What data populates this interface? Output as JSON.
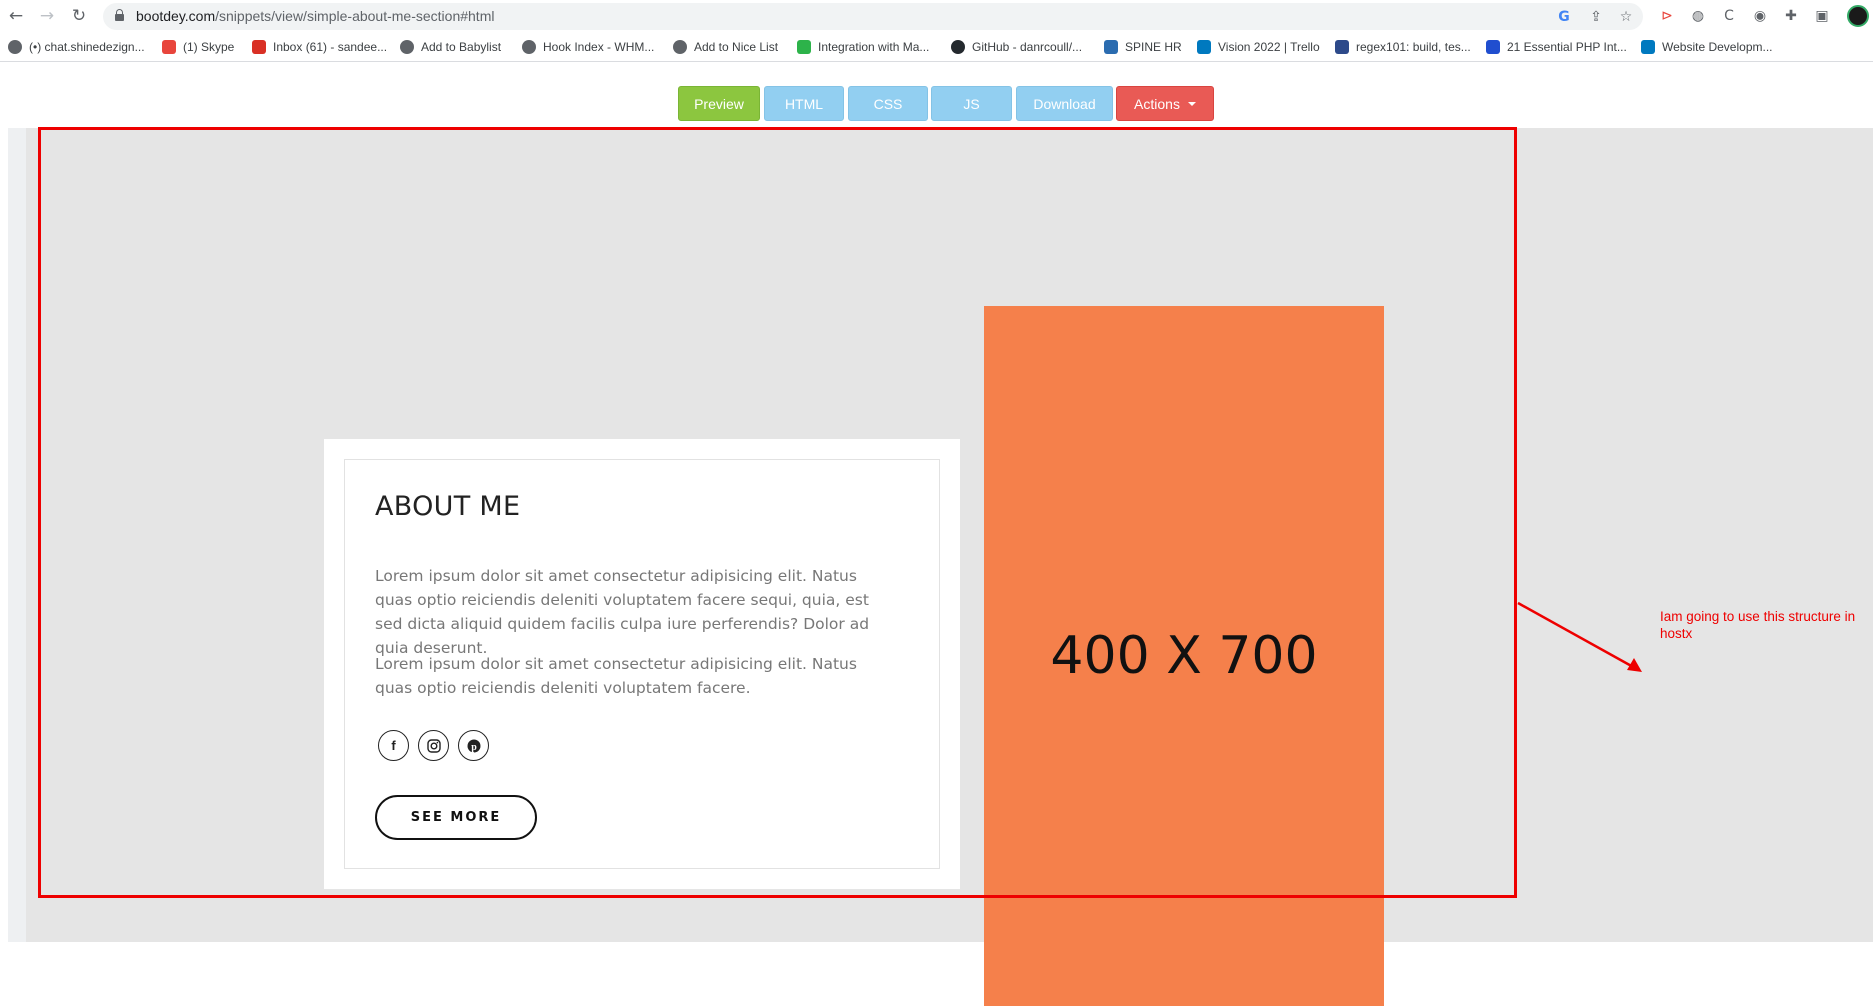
{
  "browser": {
    "url_host": "bootdey.com",
    "url_path": "/snippets/view/simple-about-me-section#html",
    "bookmarks": [
      {
        "label": "(•) chat.shinedezign...",
        "icon": "globe-icon",
        "color": "#5f6368"
      },
      {
        "label": "(1) Skype",
        "icon": "skype-icon",
        "color": "#e8453c"
      },
      {
        "label": "Inbox (61) - sandee...",
        "icon": "gmail-icon",
        "color": "#d93025"
      },
      {
        "label": "Add to Babylist",
        "icon": "globe-icon",
        "color": "#5f6368"
      },
      {
        "label": "Hook Index - WHM...",
        "icon": "globe-icon",
        "color": "#5f6368"
      },
      {
        "label": "Add to Nice List",
        "icon": "globe-icon",
        "color": "#5f6368"
      },
      {
        "label": "Integration with Ma...",
        "icon": "check-icon",
        "color": "#2db34a"
      },
      {
        "label": "GitHub - danrcoull/...",
        "icon": "github-icon",
        "color": "#24292e"
      },
      {
        "label": "SPINE HR",
        "icon": "spine-icon",
        "color": "#2b6cb0"
      },
      {
        "label": "Vision 2022 | Trello",
        "icon": "trello-icon",
        "color": "#0079bf"
      },
      {
        "label": "regex101: build, tes...",
        "icon": "regex-icon",
        "color": "#2d4a8a"
      },
      {
        "label": "21 Essential PHP Int...",
        "icon": "toptal-icon",
        "color": "#204ecf"
      },
      {
        "label": "Website Developm...",
        "icon": "trello-icon",
        "color": "#0079bf"
      }
    ]
  },
  "toolbar": {
    "buttons": [
      {
        "label": "Preview"
      },
      {
        "label": "HTML"
      },
      {
        "label": "CSS"
      },
      {
        "label": "JS"
      },
      {
        "label": "Download"
      },
      {
        "label": "Actions"
      }
    ]
  },
  "about": {
    "title": "ABOUT ME",
    "paragraph1": "Lorem ipsum dolor sit amet consectetur adipisicing elit. Natus quas optio reiciendis deleniti voluptatem facere sequi, quia, est sed dicta aliquid quidem facilis culpa iure perferendis? Dolor ad quia deserunt.",
    "paragraph2": "Lorem ipsum dolor sit amet consectetur adipisicing elit. Natus quas optio reiciendis deleniti voluptatem facere.",
    "socials": [
      "facebook-icon",
      "instagram-icon",
      "pinterest-icon"
    ],
    "button_label": "SEE MORE"
  },
  "image_placeholder": {
    "label": "400 X 700",
    "color": "#f5804b"
  },
  "annotation": {
    "text": "Iam going to use this structure in hostx",
    "color": "#ee0000"
  }
}
